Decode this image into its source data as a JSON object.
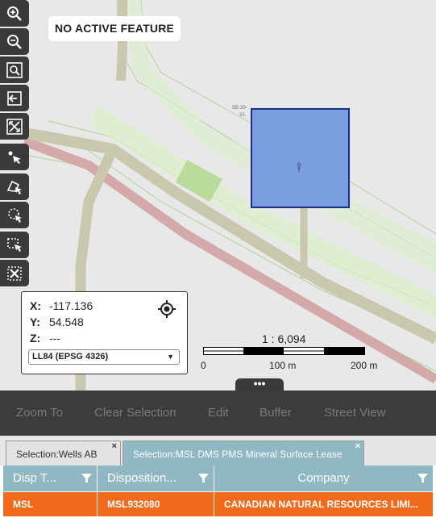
{
  "map": {
    "active_feature_text": "NO ACTIVE FEATURE",
    "parcel_label_line1": "SE-20-",
    "parcel_label_line2": "21-",
    "colors": {
      "background": "#e8e8e8",
      "road": "#c9c7ad",
      "pipeline": "#d3a9a9",
      "corridor": "#dcefc9",
      "selected_feature": "#7b9ee0",
      "selected_outline": "#1f2d8a"
    }
  },
  "toolbar": {
    "tools": [
      {
        "name": "zoom-in-icon"
      },
      {
        "name": "zoom-out-icon"
      },
      {
        "name": "zoom-extent-icon"
      },
      {
        "name": "previous-extent-icon"
      },
      {
        "name": "full-extent-icon"
      },
      {
        "name": "select-point-icon"
      },
      {
        "name": "select-polygon-icon"
      },
      {
        "name": "select-lasso-icon"
      },
      {
        "name": "select-rectangle-icon"
      },
      {
        "name": "clear-selection-icon"
      }
    ]
  },
  "coords": {
    "x_label": "X:",
    "x_value": "-117.136",
    "y_label": "Y:",
    "y_value": "54.548",
    "z_label": "Z:",
    "z_value": "---",
    "crs_selected": "LL84 (EPSG 4326)"
  },
  "scale": {
    "ratio_text": "1 : 6,094",
    "labels": [
      "0",
      "100 m",
      "200 m"
    ]
  },
  "handle": {
    "label": "•••"
  },
  "actions": {
    "zoom_to": "Zoom To",
    "clear_selection": "Clear Selection",
    "edit": "Edit",
    "buffer": "Buffer",
    "street_view": "Street View"
  },
  "tabs": [
    {
      "label": "Selection:Wells AB",
      "close": "×",
      "active": false
    },
    {
      "label": "Selection:MSL DMS PMS Mineral Surface Lease",
      "close": "×",
      "active": true
    }
  ],
  "grid": {
    "columns": [
      "Disp T...",
      "Disposition...",
      "Company"
    ],
    "rows": [
      [
        "MSL",
        "MSL932080",
        "CANADIAN NATURAL RESOURCES LIMI..."
      ]
    ],
    "colors": {
      "header": "#8fb8c4",
      "selected_row": "#f26a1b"
    }
  }
}
